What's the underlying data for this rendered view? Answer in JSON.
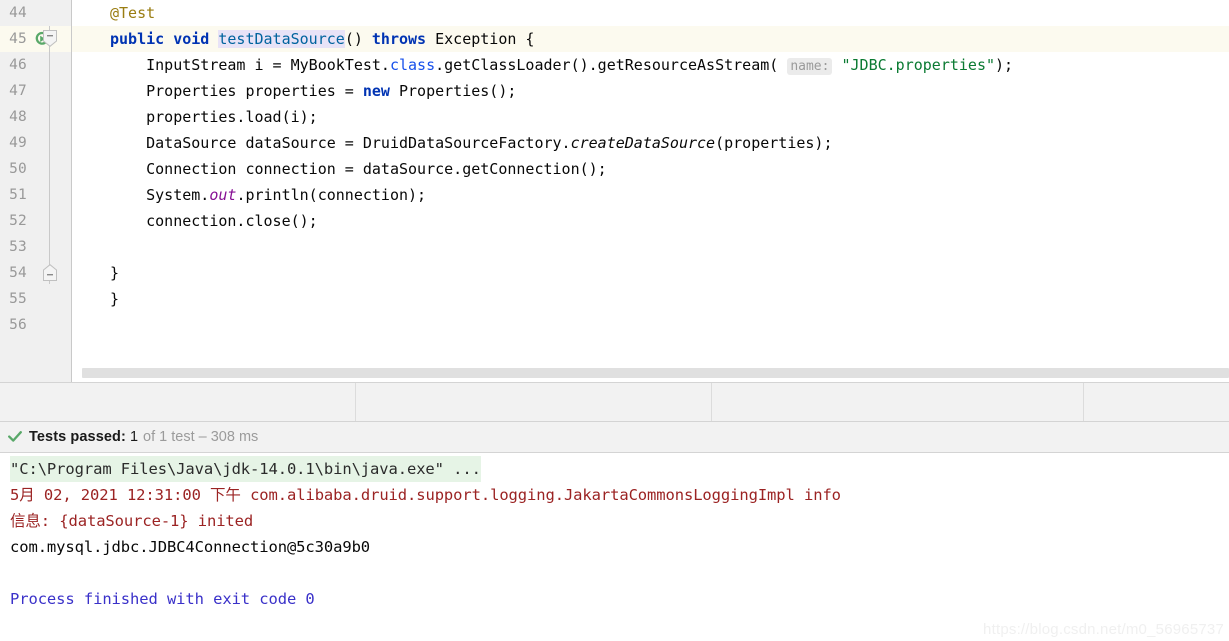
{
  "editor": {
    "first_line_number": 44,
    "current_line_number": 45,
    "gutter_icons": {
      "run_test": "run-test-icon",
      "fold_collapse": "fold-collapse-icon",
      "fold_end": "fold-end-icon"
    },
    "lines": [
      {
        "n": "44",
        "tokens": [
          {
            "t": "anno",
            "s": "@Test"
          }
        ]
      },
      {
        "n": "45",
        "current": true,
        "tokens": [
          {
            "t": "kw",
            "s": "public"
          },
          {
            "t": "plain",
            "s": " "
          },
          {
            "t": "kw",
            "s": "void"
          },
          {
            "t": "plain",
            "s": " "
          },
          {
            "t": "decl",
            "s": "testDataSource"
          },
          {
            "t": "plain",
            "s": "() "
          },
          {
            "t": "kw",
            "s": "throws"
          },
          {
            "t": "plain",
            "s": " Exception {"
          }
        ]
      },
      {
        "n": "46",
        "tokens": [
          {
            "t": "plain",
            "s": "    InputStream i = MyBookTest."
          },
          {
            "t": "field",
            "s": "class"
          },
          {
            "t": "plain",
            "s": ".getClassLoader().getResourceAsStream( "
          },
          {
            "t": "hint",
            "s": "name:"
          },
          {
            "t": "plain",
            "s": " "
          },
          {
            "t": "str",
            "s": "\"JDBC.properties\""
          },
          {
            "t": "plain",
            "s": ");"
          }
        ]
      },
      {
        "n": "47",
        "tokens": [
          {
            "t": "plain",
            "s": "    Properties properties = "
          },
          {
            "t": "kw",
            "s": "new"
          },
          {
            "t": "plain",
            "s": " Properties();"
          }
        ]
      },
      {
        "n": "48",
        "tokens": [
          {
            "t": "plain",
            "s": "    properties.load(i);"
          }
        ]
      },
      {
        "n": "49",
        "tokens": [
          {
            "t": "plain",
            "s": "    DataSource dataSource = DruidDataSourceFactory."
          },
          {
            "t": "stmeth",
            "s": "createDataSource"
          },
          {
            "t": "plain",
            "s": "(properties);"
          }
        ]
      },
      {
        "n": "50",
        "tokens": [
          {
            "t": "plain",
            "s": "    Connection connection = dataSource.getConnection();"
          }
        ]
      },
      {
        "n": "51",
        "tokens": [
          {
            "t": "plain",
            "s": "    System."
          },
          {
            "t": "static",
            "s": "out"
          },
          {
            "t": "plain",
            "s": ".println(connection);"
          }
        ]
      },
      {
        "n": "52",
        "tokens": [
          {
            "t": "plain",
            "s": "    connection.close();"
          }
        ]
      },
      {
        "n": "53",
        "tokens": [
          {
            "t": "plain",
            "s": ""
          }
        ]
      },
      {
        "n": "54",
        "tokens": [
          {
            "t": "brace",
            "s": "}"
          }
        ]
      },
      {
        "n": "55",
        "tokens": [
          {
            "t": "brace",
            "s": "}"
          }
        ]
      },
      {
        "n": "56",
        "tokens": [
          {
            "t": "plain",
            "s": ""
          }
        ]
      }
    ]
  },
  "status_bar": {
    "icon": "green-check-icon",
    "passed_label": "Tests passed:",
    "passed_count": "1",
    "detail": "of 1 test – 308 ms"
  },
  "console": {
    "lines": [
      {
        "cls": "c-cmd",
        "s": "\"C:\\Program Files\\Java\\jdk-14.0.1\\bin\\java.exe\" ..."
      },
      {
        "cls": "c-err",
        "s": "5月 02, 2021 12:31:00 下午 com.alibaba.druid.support.logging.JakartaCommonsLoggingImpl info"
      },
      {
        "cls": "c-err",
        "s": "信息: {dataSource-1} inited"
      },
      {
        "cls": "c-out",
        "s": "com.mysql.jdbc.JDBC4Connection@5c30a9b0"
      },
      {
        "cls": "c-out",
        "s": ""
      },
      {
        "cls": "c-exit",
        "s": "Process finished with exit code 0"
      }
    ]
  },
  "watermark": {
    "text": "https://blog.csdn.net/m0_56965737"
  },
  "colors": {
    "keyword": "#0033b3",
    "string": "#0a7a32",
    "annotation": "#9a7d12",
    "static_field": "#871094",
    "declaration": "#00639e",
    "current_line_bg": "#fcfaef",
    "gutter_bg": "#f0f0f0",
    "console_error": "#9b2323",
    "console_exit": "#3a31c9",
    "success_green": "#59a869",
    "cmd_highlight_bg": "#e6f4e6"
  }
}
